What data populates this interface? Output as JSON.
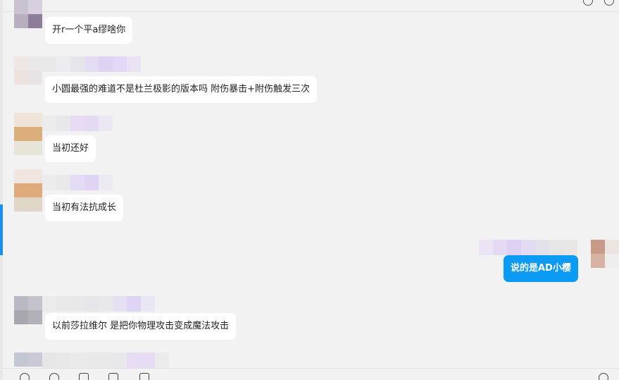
{
  "messages": [
    {
      "text": "开r一个平a缪啥你",
      "self": false
    },
    {
      "text": "小圆最强的难道不是杜兰极影的版本吗 附伤暴击+附伤触发三次",
      "self": false
    },
    {
      "text": "当初还好",
      "self": false
    },
    {
      "text": "当初有法抗成长",
      "self": false
    },
    {
      "text": "说的是AD小樱",
      "self": true
    },
    {
      "text": "以前莎拉维尔 是把你物理攻击变成魔法攻击",
      "self": false
    }
  ],
  "toolbar": {
    "icons": [
      "emoji-icon",
      "scissors-icon",
      "folder-icon",
      "image-icon",
      "mic-icon",
      "history-icon"
    ]
  },
  "colors": {
    "background": "#f2f2f2",
    "bubble_other": "#ffffff",
    "bubble_self": "#0b9bf5",
    "accent": "#1b8ff0"
  }
}
